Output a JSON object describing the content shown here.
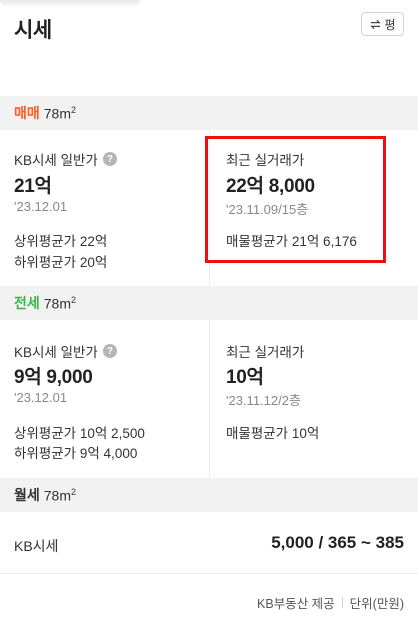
{
  "header": {
    "title": "시세",
    "unit_toggle_label": "평"
  },
  "sale": {
    "type": "매매",
    "type_color": "#ff5a1f",
    "area": "78m",
    "area_sup": "2",
    "kb": {
      "label": "KB시세 일반가",
      "price": "21억",
      "date": "'23.12.01",
      "upper_label": "상위평균가",
      "upper_value": "22억",
      "lower_label": "하위평균가",
      "lower_value": "20억"
    },
    "recent": {
      "label": "최근 실거래가",
      "price": "22억 8,000",
      "date": "'23.11.09/15층",
      "listing_label": "매물평균가",
      "listing_value": "21억 6,176"
    }
  },
  "jeonse": {
    "type": "전세",
    "type_color": "#3ab54a",
    "area": "78m",
    "area_sup": "2",
    "kb": {
      "label": "KB시세 일반가",
      "price": "9억 9,000",
      "date": "'23.12.01",
      "upper_label": "상위평균가",
      "upper_value": "10억 2,500",
      "lower_label": "하위평균가",
      "lower_value": "9억 4,000"
    },
    "recent": {
      "label": "최근 실거래가",
      "price": "10억",
      "date": "'23.11.12/2층",
      "listing_label": "매물평균가",
      "listing_value": "10억"
    }
  },
  "wolse": {
    "type": "월세",
    "area": "78m",
    "area_sup": "2",
    "label": "KB시세",
    "value": "5,000 / 365 ~ 385"
  },
  "footer": {
    "source": "KB부동산 제공",
    "unit": "단위(만원)"
  },
  "icons": {
    "help": "?",
    "swap": "swap-arrows-icon"
  },
  "colors": {
    "highlight_border": "#ee0f0f"
  }
}
